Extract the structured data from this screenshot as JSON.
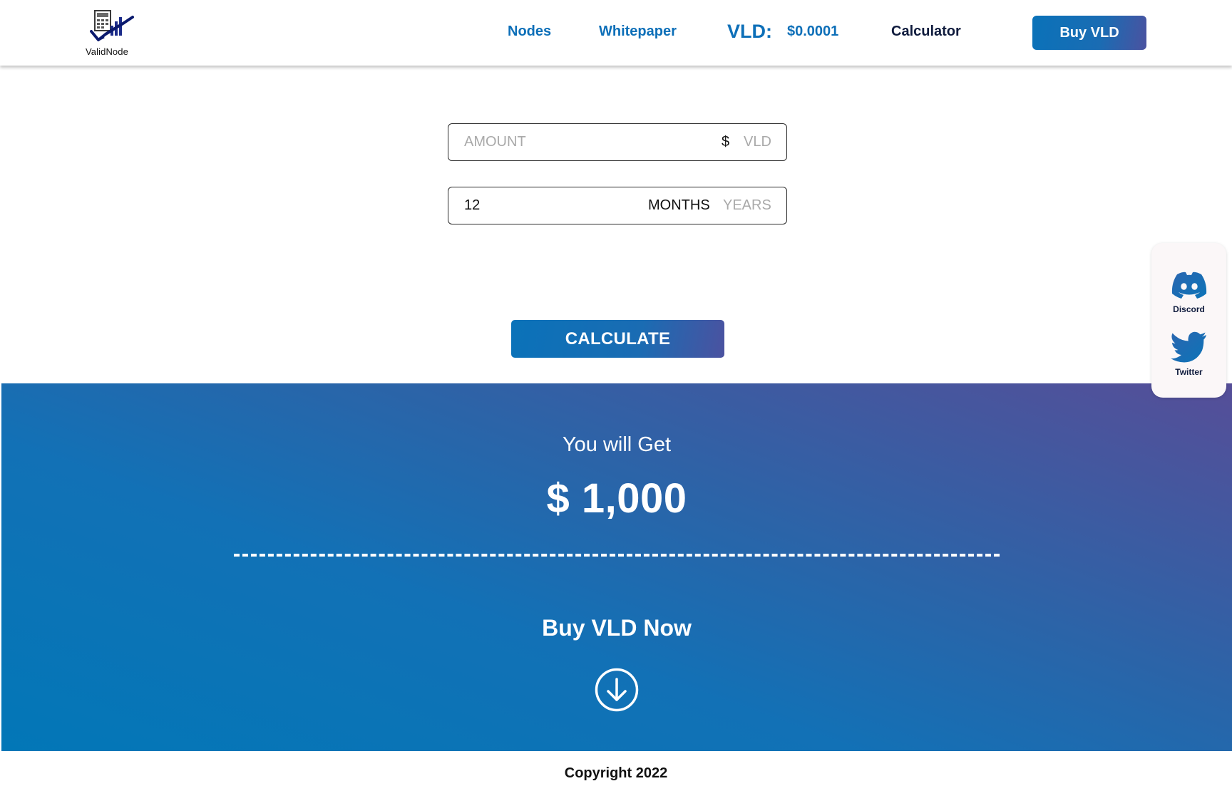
{
  "brand": {
    "name": "ValidNode"
  },
  "nav": {
    "items": [
      {
        "label": "Nodes"
      },
      {
        "label": "Whitepaper"
      }
    ],
    "price_label": "VLD:",
    "price_value": "$0.0001",
    "calculator": "Calculator",
    "buy_button": "Buy VLD"
  },
  "calculator": {
    "amount": {
      "placeholder": "AMOUNT",
      "value": "",
      "units": [
        "$",
        "VLD"
      ],
      "selected_unit": "$"
    },
    "period": {
      "value": "12",
      "units": [
        "MONTHS",
        "YEARS"
      ],
      "selected_unit": "MONTHS"
    },
    "button": "CALCULATE"
  },
  "result": {
    "label": "You will Get",
    "value": "$ 1,000",
    "cta": "Buy VLD Now",
    "cta_icon": "arrow-down-circle-icon"
  },
  "social": [
    {
      "label": "Discord",
      "icon": "discord-icon"
    },
    {
      "label": "Twitter",
      "icon": "twitter-icon"
    }
  ],
  "footer": {
    "copyright": "Copyright 2022"
  },
  "colors": {
    "brand_blue": "#0d6fb8",
    "navy": "#0f1b3d",
    "gradient_start": "#0277b7",
    "gradient_end": "#564e98"
  }
}
